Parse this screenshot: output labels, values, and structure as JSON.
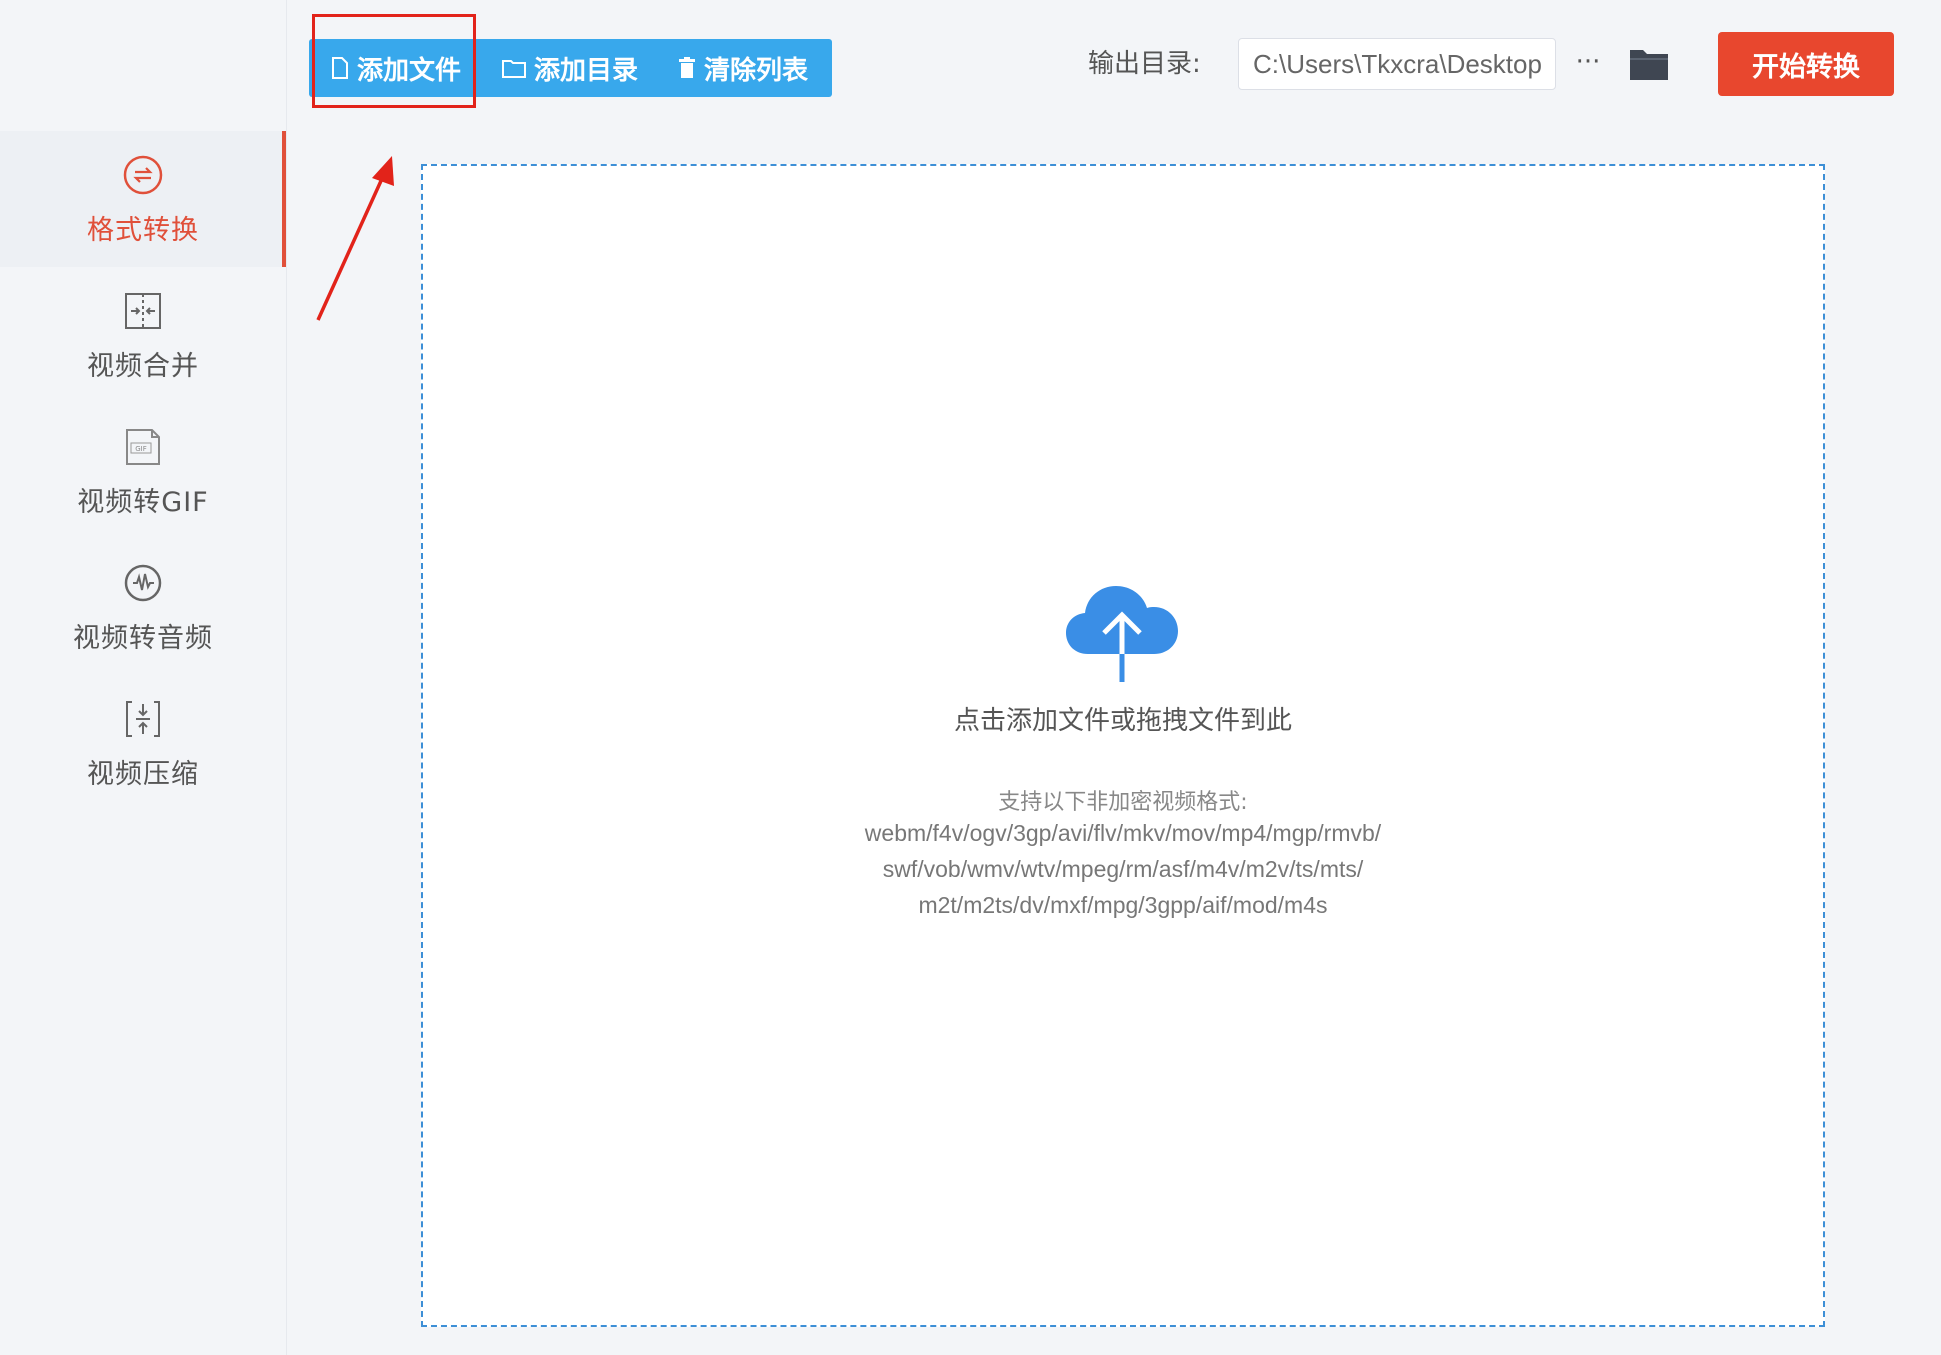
{
  "toolbar": {
    "add_file": "添加文件",
    "add_dir": "添加目录",
    "clear_list": "清除列表",
    "output_label": "输出目录:",
    "output_path": "C:\\Users\\Tkxcra\\Desktop",
    "more": "···",
    "start": "开始转换",
    "accent": "#38a8ec",
    "start_color": "#e8472e"
  },
  "sidebar": {
    "items": [
      {
        "label": "格式转换",
        "icon": "format-convert-icon",
        "active": true
      },
      {
        "label": "视频合并",
        "icon": "video-merge-icon"
      },
      {
        "label": "视频转GIF",
        "icon": "gif-icon"
      },
      {
        "label": "视频转音频",
        "icon": "audio-icon"
      },
      {
        "label": "视频压缩",
        "icon": "compress-icon"
      }
    ],
    "active_color": "#e0503a"
  },
  "dropzone": {
    "title": "点击添加文件或拖拽文件到此",
    "support_label": "支持以下非加密视频格式:",
    "formats": [
      "webm/f4v/ogv/3gp/avi/flv/mkv/mov/mp4/mgp/rmvb/",
      "swf/vob/wmv/wtv/mpeg/rm/asf/m4v/m2v/ts/mts/",
      "m2t/m2ts/dv/mxf/mpg/3gpp/aif/mod/m4s"
    ],
    "cloud_color": "#3a8ee6"
  },
  "annotation": {
    "color": "#e2231a"
  }
}
